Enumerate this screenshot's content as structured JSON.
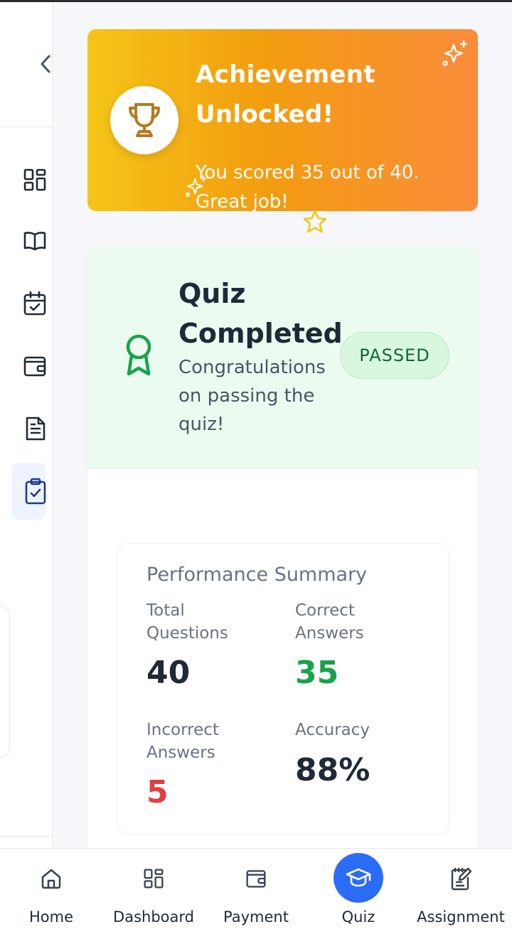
{
  "achievement": {
    "title": "Achievement Unlocked!",
    "message": "You scored 35 out of 40. Great job!"
  },
  "quiz": {
    "title": "Quiz Completed",
    "subtitle": "Congratulations on passing the quiz!",
    "status": "PASSED"
  },
  "performance": {
    "title": "Performance Summary",
    "stats": [
      {
        "label": "Total Questions",
        "value": "40",
        "color": "#1f2937"
      },
      {
        "label": "Correct Answers",
        "value": "35",
        "color": "#16a34a"
      },
      {
        "label": "Incorrect Answers",
        "value": "5",
        "color": "#e53e3e"
      },
      {
        "label": "Accuracy",
        "value": "88%",
        "color": "#1f2937"
      }
    ]
  },
  "sidebar": {
    "items": [
      {
        "icon": "dashboard-icon"
      },
      {
        "icon": "book-icon"
      },
      {
        "icon": "calendar-check-icon"
      },
      {
        "icon": "wallet-icon"
      },
      {
        "icon": "document-icon"
      },
      {
        "icon": "clipboard-check-icon",
        "active": true
      }
    ]
  },
  "bottom_nav": {
    "items": [
      {
        "label": "Home",
        "icon": "home-icon"
      },
      {
        "label": "Dashboard",
        "icon": "dashboard-icon"
      },
      {
        "label": "Payment",
        "icon": "wallet-icon"
      },
      {
        "label": "Quiz",
        "icon": "graduation-cap-icon",
        "active": true
      },
      {
        "label": "Assignment",
        "icon": "edit-document-icon"
      }
    ]
  },
  "colors": {
    "accent": "#2b6cf6",
    "success": "#16a34a",
    "danger": "#e53e3e",
    "banner_start": "#f5c518",
    "banner_end": "#fb8c3c"
  }
}
